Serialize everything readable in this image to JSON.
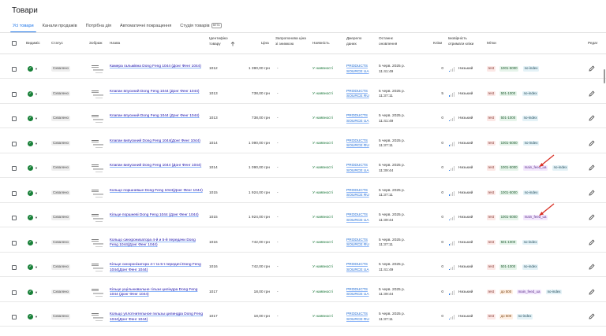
{
  "page": {
    "title": "Товари"
  },
  "tabs": [
    {
      "label": "Усі товари"
    },
    {
      "label": "Канали продажів"
    },
    {
      "label": "Потрібна дія"
    },
    {
      "label": "Автоматичні покращення"
    },
    {
      "label": "Студія товарів",
      "badge": "BETA"
    }
  ],
  "columns": {
    "visibility": "Видиміс",
    "status": "Статус",
    "image": "Зображ",
    "name": "Назва",
    "id": "Ідентифіко товару",
    "price": "Ціна",
    "sale_price": "Запропонова ціна зі знижкою",
    "availability": "Наявність",
    "source": "Джерело даних",
    "updated": "Останнє оновлення",
    "clicks": "Кліки",
    "click_prob": "Імовірність отримати кліки",
    "labels": "Мітки",
    "edit": "Редаг"
  },
  "colors": {
    "accent": "#1a73e8",
    "ok": "#188038",
    "arrow": "#d93025"
  },
  "rows": [
    {
      "name": "Камера гальмівна Dong Feng 1044 (Донг Фенг 1044)",
      "id": "1012",
      "price": "1 390,00 грн",
      "sale": "-",
      "availability": "У наявності",
      "source": "PRODUCTS SOURCE UA",
      "date": "5 черв. 2025 р.",
      "time": "11:41:49",
      "clicks": "0",
      "prob": "Низький",
      "status": "Схвалено",
      "labels": [
        {
          "text": "rest",
          "c": "t-red"
        },
        {
          "text": "1001-5000",
          "c": "t-green"
        },
        {
          "text": "no-index",
          "c": "t-blue"
        }
      ]
    },
    {
      "name": "Клапан впускний Dong Feng 1044 (Донг Фенг 1044)",
      "id": "1013",
      "price": "738,00 грн",
      "sale": "-",
      "availability": "У наявності",
      "source": "PRODUCTS SOURCE RU",
      "date": "5 черв. 2025 р.",
      "time": "11:37:11",
      "clicks": "5",
      "prob": "Низький",
      "status": "Схвалено",
      "labels": [
        {
          "text": "rest",
          "c": "t-red"
        },
        {
          "text": "501-1000",
          "c": "t-green"
        },
        {
          "text": "no-index",
          "c": "t-blue"
        }
      ]
    },
    {
      "name": "Клапан впускний Dong Feng 1044 (Донг Фенг 1044)",
      "id": "1013",
      "price": "738,00 грн",
      "sale": "-",
      "availability": "У наявності",
      "source": "PRODUCTS SOURCE UA",
      "date": "5 черв. 2025 р.",
      "time": "11:41:49",
      "clicks": "0",
      "prob": "Низький",
      "status": "Схвалено",
      "labels": [
        {
          "text": "rest",
          "c": "t-red"
        },
        {
          "text": "501-1000",
          "c": "t-green"
        },
        {
          "text": "no-index",
          "c": "t-blue"
        }
      ]
    },
    {
      "name": "Клапан випускний Dong Feng 1044(Донг Фенг 1044)",
      "id": "1014",
      "price": "1 090,00 грн",
      "sale": "-",
      "availability": "У наявності",
      "source": "PRODUCTS SOURCE RU",
      "date": "5 черв. 2025 р.",
      "time": "11:37:11",
      "clicks": "0",
      "prob": "Низький",
      "status": "Схвалено",
      "labels": [
        {
          "text": "rest",
          "c": "t-red"
        },
        {
          "text": "1001-5000",
          "c": "t-green"
        },
        {
          "text": "no-index",
          "c": "t-blue"
        }
      ]
    },
    {
      "name": "Клапан випускний Dong Feng 1044 (Донг Фенг 1044)",
      "id": "1014",
      "price": "1 090,00 грн",
      "sale": "-",
      "availability": "У наявності",
      "source": "PRODUCTS SOURCE UA",
      "date": "5 черв. 2025 р.",
      "time": "11:39:44",
      "clicks": "0",
      "prob": "Низький",
      "status": "Схвалено",
      "labels": [
        {
          "text": "rest",
          "c": "t-red"
        },
        {
          "text": "1001-5000",
          "c": "t-green"
        },
        {
          "text": "main_feed_ua",
          "c": "t-purple"
        },
        {
          "text": "no-index",
          "c": "t-blue"
        }
      ]
    },
    {
      "name": "Кольцо поршневые Dong Feng 1044(Донг Фенг 1044)",
      "id": "1015",
      "price": "1 924,00 грн",
      "sale": "-",
      "availability": "У наявності",
      "source": "PRODUCTS SOURCE RU",
      "date": "5 черв. 2025 р.",
      "time": "11:37:11",
      "clicks": "0",
      "prob": "Низький",
      "status": "Схвалено",
      "labels": [
        {
          "text": "rest",
          "c": "t-red"
        },
        {
          "text": "1001-5000",
          "c": "t-green"
        },
        {
          "text": "no-index",
          "c": "t-blue"
        }
      ]
    },
    {
      "name": "Кільце поршневі Dong Feng 1044 (Донг Фенг 1044)",
      "id": "1015",
      "price": "1 924,00 грн",
      "sale": "-",
      "availability": "У наявності",
      "source": "PRODUCTS SOURCE UA",
      "date": "5 черв. 2025 р.",
      "time": "11:39:44",
      "clicks": "0",
      "prob": "Низький",
      "status": "Схвалено",
      "labels": [
        {
          "text": "rest",
          "c": "t-red"
        },
        {
          "text": "1001-5000",
          "c": "t-green"
        },
        {
          "text": "main_feed_ua",
          "c": "t-purple"
        }
      ]
    },
    {
      "name": "Кольцо синхронизатора 4-й и 5-й передачи Dong Feng 1044(Донг Фенг 1044)",
      "id": "1016",
      "price": "742,00 грн",
      "sale": "-",
      "availability": "У наявності",
      "source": "PRODUCTS SOURCE RU",
      "date": "5 черв. 2025 р.",
      "time": "11:37:11",
      "clicks": "0",
      "prob": "Низький",
      "status": "Схвалено",
      "labels": [
        {
          "text": "rest",
          "c": "t-red"
        },
        {
          "text": "501-1000",
          "c": "t-green"
        },
        {
          "text": "no-index",
          "c": "t-blue"
        }
      ]
    },
    {
      "name": "Кільце синхронізатора 4-ї та 5-ї передачі Dong Feng 1044(Донг Фенг 1044)",
      "id": "1016",
      "price": "742,00 грн",
      "sale": "-",
      "availability": "У наявності",
      "source": "PRODUCTS SOURCE UA",
      "date": "5 черв. 2025 р.",
      "time": "11:41:49",
      "clicks": "0",
      "prob": "Низький",
      "status": "Схвалено",
      "labels": [
        {
          "text": "rest",
          "c": "t-red"
        },
        {
          "text": "501-1000",
          "c": "t-green"
        },
        {
          "text": "no-index",
          "c": "t-blue"
        }
      ]
    },
    {
      "name": "Кільце ущільнювальне гільзи циліндра Dong Feng 1044 (Донг Фенг 1044)",
      "id": "1017",
      "price": "18,00 грн",
      "sale": "-",
      "availability": "У наявності",
      "source": "PRODUCTS SOURCE UA",
      "date": "5 черв. 2025 р.",
      "time": "11:39:44",
      "clicks": "0",
      "prob": "Низький",
      "status": "Схвалено",
      "labels": [
        {
          "text": "rest",
          "c": "t-red"
        },
        {
          "text": "до 500",
          "c": "t-orange"
        },
        {
          "text": "main_feed_ua",
          "c": "t-purple"
        },
        {
          "text": "no-index",
          "c": "t-blue"
        }
      ]
    },
    {
      "name": "Кольцо уплотнительное гильзы цилиндра Dong Feng 1044(Донг Фенг 1044)",
      "id": "1017",
      "price": "18,00 грн",
      "sale": "-",
      "availability": "У наявності",
      "source": "PRODUCTS SOURCE RU",
      "date": "5 черв. 2025 р.",
      "time": "11:37:11",
      "clicks": "0",
      "prob": "Низький",
      "status": "Схвалено",
      "labels": [
        {
          "text": "rest",
          "c": "t-red"
        },
        {
          "text": "до 500",
          "c": "t-orange"
        },
        {
          "text": "no-index",
          "c": "t-blue"
        }
      ]
    }
  ]
}
